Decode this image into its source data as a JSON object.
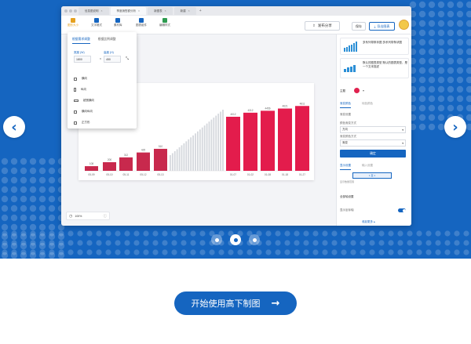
{
  "app": {
    "tabs": [
      {
        "label": "信息图说明"
      },
      {
        "label": "季度销售额分析"
      },
      {
        "label": "新图表"
      },
      {
        "label": "新建"
      }
    ],
    "toolbar": {
      "items": [
        {
          "label": "图形大小",
          "icon": "brush-icon",
          "color": "#e6a11f"
        },
        {
          "label": "文字格式",
          "icon": "text-icon",
          "color": "#1565c0"
        },
        {
          "label": "素材库",
          "icon": "library-icon",
          "color": "#1565c0"
        },
        {
          "label": "图表组件",
          "icon": "chart-icon",
          "color": "#1565c0"
        },
        {
          "label": "编辑样式",
          "icon": "pen-icon",
          "color": "#2e9b50"
        }
      ],
      "publish_label": "发布分享",
      "save_label": "保存",
      "export_label": "导出图表"
    },
    "size_popup": {
      "tabs": [
        "根据需求调整",
        "根据比例调整"
      ],
      "width_label": "宽度 (W)",
      "height_label": "高度 (H)",
      "width_value": "1800",
      "height_value": "450",
      "multiply": "x",
      "options": [
        "横向",
        "纵向",
        "超宽横向",
        "横向纵向",
        "正方形"
      ]
    },
    "zoom": {
      "value": "100%"
    },
    "right_panel": {
      "cards": [
        {
          "title": "多系列带条状图 多系列带条状图"
        },
        {
          "title": "默认的图表类型 默认的图表类型，是一个文本描述"
        }
      ],
      "color_label": "主题",
      "color_value": "#e0224f",
      "tabs": [
        "渐变颜色",
        "纯色颜色"
      ],
      "fields": [
        {
          "label": "渐变设置",
          "value": ""
        },
        {
          "label": "颜色渐变方式",
          "value": "方向"
        },
        {
          "label": "渐变颜色方式",
          "value": "渐变"
        }
      ],
      "confirm_label": "确定",
      "sub_tabs": [
        "显示设置",
        "输入设置"
      ],
      "range_value": "1 至 1",
      "range_caption": "显示数量范围",
      "section_label": "全部轴设置",
      "toggle_label": "显示坐标轴",
      "collapse_label": "收起更多"
    }
  },
  "chart_data": {
    "type": "bar",
    "series": [
      {
        "values": [
          108,
          200,
          312,
          425,
          510
        ]
      },
      {
        "values": [
          4012,
          4312,
          4456,
          4621,
          4811
        ]
      }
    ],
    "xlabels_left": [
      "05-09",
      "05-10",
      "05-11",
      "05-12",
      "05-13"
    ],
    "xlabels_right": [
      "01-07",
      "01-02",
      "01-08",
      "01-18",
      "01-27"
    ],
    "data_labels_left": [
      "108",
      "200",
      "312",
      "425",
      "510"
    ],
    "data_labels_right": [
      "4012",
      "4312",
      "4456",
      "4621",
      "4811"
    ],
    "colors": {
      "left": "#c8294d",
      "right": "#e31c4c",
      "mid": "#d5d8dd"
    }
  },
  "carousel": {
    "pages": 3,
    "active": 1
  },
  "cta": {
    "label": "开始使用高下制图"
  },
  "colors": {
    "brand": "#1565c0",
    "accent": "#e31c4c",
    "white": "#ffffff"
  }
}
